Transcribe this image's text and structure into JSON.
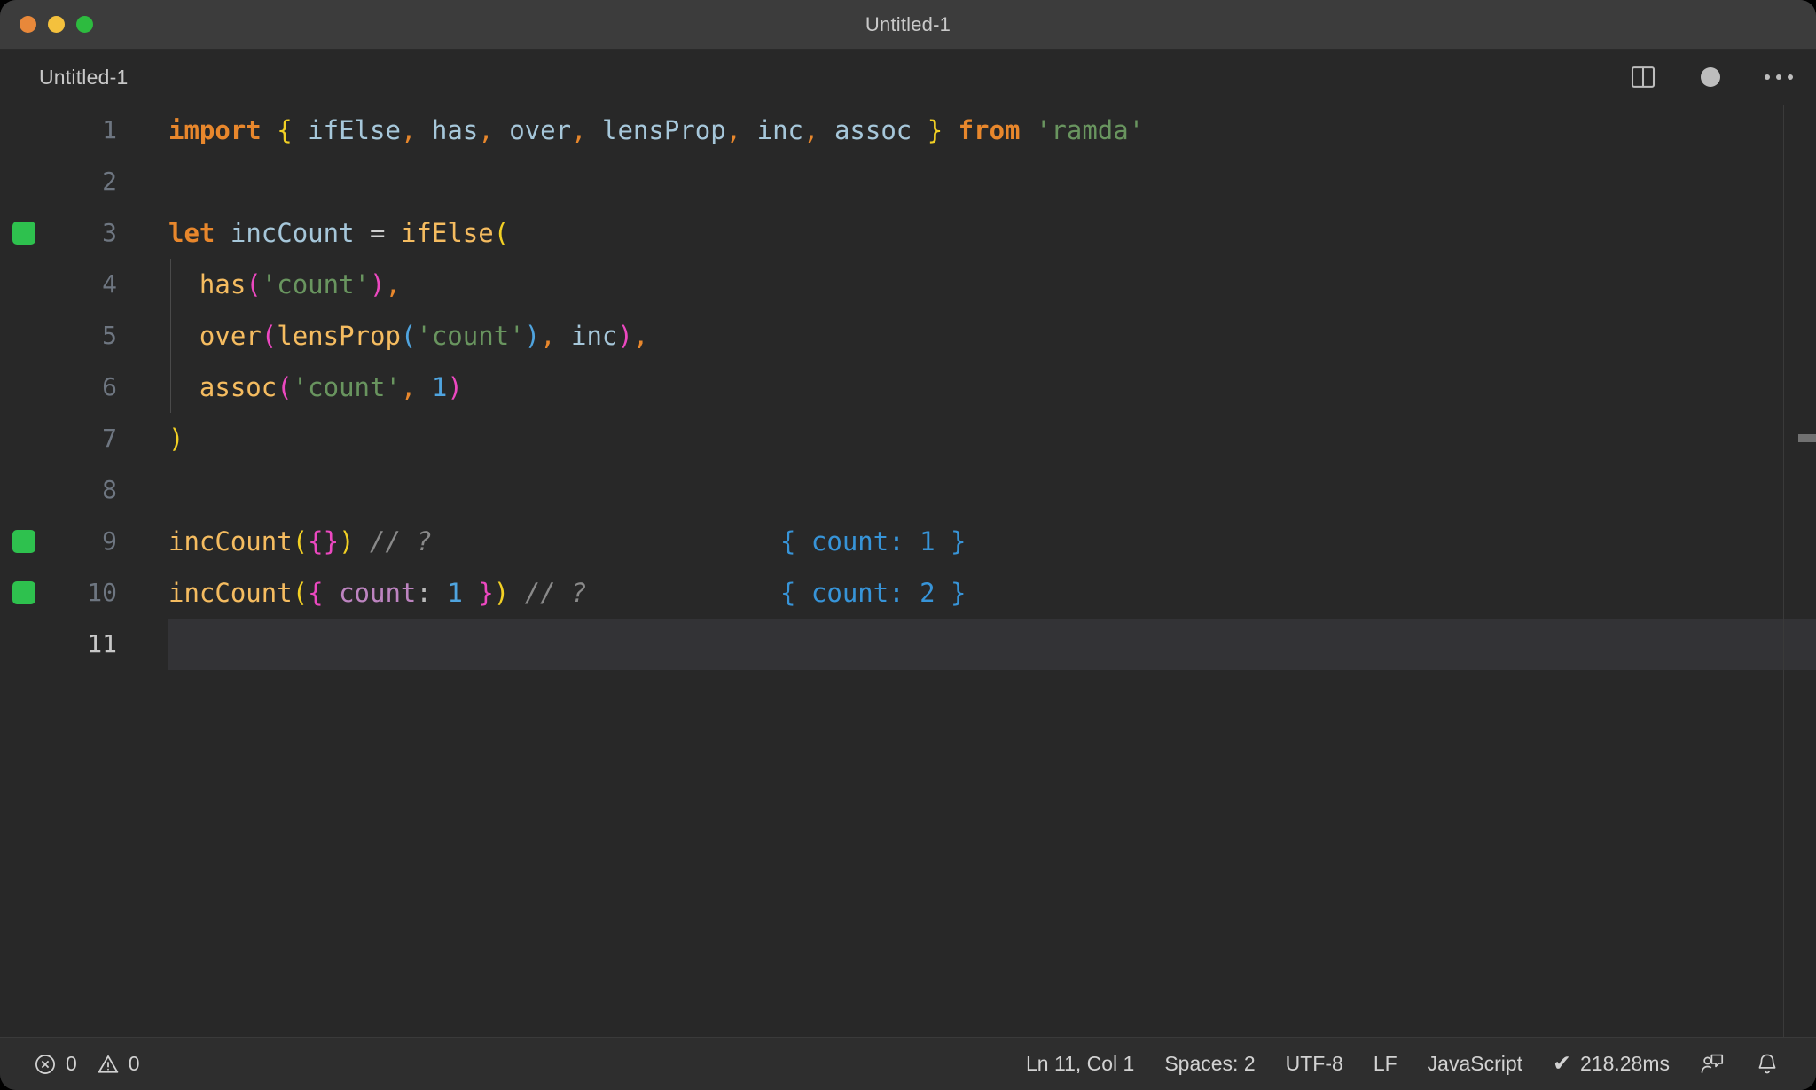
{
  "window": {
    "title": "Untitled-1",
    "traffic_lights": [
      {
        "name": "close",
        "color": "#e8883a"
      },
      {
        "name": "minimize",
        "color": "#f4c13d"
      },
      {
        "name": "maximize",
        "color": "#2dbb3f"
      }
    ]
  },
  "tabstrip": {
    "tab_label": "Untitled-1",
    "actions": [
      {
        "icon": "split-editor-icon"
      },
      {
        "icon": "unsaved-dot-icon"
      },
      {
        "icon": "more-actions-icon"
      }
    ]
  },
  "editor": {
    "language": "JavaScript",
    "current_line": 11,
    "lines": [
      {
        "n": "1",
        "marked": false,
        "indent_guide": false
      },
      {
        "n": "2",
        "marked": false,
        "indent_guide": false
      },
      {
        "n": "3",
        "marked": true,
        "indent_guide": false
      },
      {
        "n": "4",
        "marked": false,
        "indent_guide": true
      },
      {
        "n": "5",
        "marked": false,
        "indent_guide": true
      },
      {
        "n": "6",
        "marked": false,
        "indent_guide": true
      },
      {
        "n": "7",
        "marked": false,
        "indent_guide": false
      },
      {
        "n": "8",
        "marked": false,
        "indent_guide": false
      },
      {
        "n": "9",
        "marked": true,
        "indent_guide": false
      },
      {
        "n": "10",
        "marked": true,
        "indent_guide": false
      },
      {
        "n": "11",
        "marked": false,
        "indent_guide": false
      }
    ],
    "source_text": [
      "import { ifElse, has, over, lensProp, inc, assoc } from 'ramda'",
      "",
      "let incCount = ifElse(",
      "  has('count'),",
      "  over(lensProp('count'), inc),",
      "  assoc('count', 1)",
      ")",
      "",
      "incCount({}) // ?",
      "incCount({ count: 1 }) // ?",
      ""
    ],
    "inline_results": [
      {
        "line": 9,
        "value": "{ count: 1 }"
      },
      {
        "line": 10,
        "value": "{ count: 2 }"
      }
    ],
    "tokens": {
      "l1": [
        {
          "t": "import",
          "c": "kw"
        },
        {
          "t": " ",
          "c": "punc"
        },
        {
          "t": "{",
          "c": "br1"
        },
        {
          "t": " ",
          "c": "punc"
        },
        {
          "t": "ifElse",
          "c": "ident"
        },
        {
          "t": ",",
          "c": "comma"
        },
        {
          "t": " ",
          "c": "punc"
        },
        {
          "t": "has",
          "c": "ident"
        },
        {
          "t": ",",
          "c": "comma"
        },
        {
          "t": " ",
          "c": "punc"
        },
        {
          "t": "over",
          "c": "ident"
        },
        {
          "t": ",",
          "c": "comma"
        },
        {
          "t": " ",
          "c": "punc"
        },
        {
          "t": "lensProp",
          "c": "ident"
        },
        {
          "t": ",",
          "c": "comma"
        },
        {
          "t": " ",
          "c": "punc"
        },
        {
          "t": "inc",
          "c": "ident"
        },
        {
          "t": ",",
          "c": "comma"
        },
        {
          "t": " ",
          "c": "punc"
        },
        {
          "t": "assoc",
          "c": "ident"
        },
        {
          "t": " ",
          "c": "punc"
        },
        {
          "t": "}",
          "c": "br1"
        },
        {
          "t": " ",
          "c": "punc"
        },
        {
          "t": "from",
          "c": "kw"
        },
        {
          "t": " ",
          "c": "punc"
        },
        {
          "t": "'ramda'",
          "c": "str"
        }
      ],
      "l3": [
        {
          "t": "let",
          "c": "kw"
        },
        {
          "t": " ",
          "c": "punc"
        },
        {
          "t": "incCount",
          "c": "ident"
        },
        {
          "t": " ",
          "c": "punc"
        },
        {
          "t": "=",
          "c": "op"
        },
        {
          "t": " ",
          "c": "punc"
        },
        {
          "t": "ifElse",
          "c": "fn"
        },
        {
          "t": "(",
          "c": "br1"
        }
      ],
      "l4": [
        {
          "t": "  ",
          "c": "punc"
        },
        {
          "t": "has",
          "c": "fn"
        },
        {
          "t": "(",
          "c": "br2"
        },
        {
          "t": "'count'",
          "c": "str"
        },
        {
          "t": ")",
          "c": "br2"
        },
        {
          "t": ",",
          "c": "comma"
        }
      ],
      "l5": [
        {
          "t": "  ",
          "c": "punc"
        },
        {
          "t": "over",
          "c": "fn"
        },
        {
          "t": "(",
          "c": "br2"
        },
        {
          "t": "lensProp",
          "c": "fn"
        },
        {
          "t": "(",
          "c": "br3"
        },
        {
          "t": "'count'",
          "c": "str"
        },
        {
          "t": ")",
          "c": "br3"
        },
        {
          "t": ",",
          "c": "comma"
        },
        {
          "t": " ",
          "c": "punc"
        },
        {
          "t": "inc",
          "c": "ident"
        },
        {
          "t": ")",
          "c": "br2"
        },
        {
          "t": ",",
          "c": "comma"
        }
      ],
      "l6": [
        {
          "t": "  ",
          "c": "punc"
        },
        {
          "t": "assoc",
          "c": "fn"
        },
        {
          "t": "(",
          "c": "br2"
        },
        {
          "t": "'count'",
          "c": "str"
        },
        {
          "t": ",",
          "c": "comma"
        },
        {
          "t": " ",
          "c": "punc"
        },
        {
          "t": "1",
          "c": "num"
        },
        {
          "t": ")",
          "c": "br2"
        }
      ],
      "l7": [
        {
          "t": ")",
          "c": "br1"
        }
      ],
      "l9": [
        {
          "t": "incCount",
          "c": "fn"
        },
        {
          "t": "(",
          "c": "br1"
        },
        {
          "t": "{",
          "c": "br2"
        },
        {
          "t": "}",
          "c": "br2"
        },
        {
          "t": ")",
          "c": "br1"
        },
        {
          "t": " ",
          "c": "punc"
        },
        {
          "t": "// ?",
          "c": "comment"
        }
      ],
      "l10": [
        {
          "t": "incCount",
          "c": "fn"
        },
        {
          "t": "(",
          "c": "br1"
        },
        {
          "t": "{",
          "c": "br2"
        },
        {
          "t": " ",
          "c": "punc"
        },
        {
          "t": "count",
          "c": "prop"
        },
        {
          "t": ":",
          "c": "punc"
        },
        {
          "t": " ",
          "c": "punc"
        },
        {
          "t": "1",
          "c": "num"
        },
        {
          "t": " ",
          "c": "punc"
        },
        {
          "t": "}",
          "c": "br2"
        },
        {
          "t": ")",
          "c": "br1"
        },
        {
          "t": " ",
          "c": "punc"
        },
        {
          "t": "// ?",
          "c": "comment"
        }
      ]
    }
  },
  "statusbar": {
    "errors_count": "0",
    "warnings_count": "0",
    "cursor_position": "Ln 11, Col 1",
    "indentation": "Spaces: 2",
    "encoding": "UTF-8",
    "eol": "LF",
    "language_mode": "JavaScript",
    "run_time": "218.28ms",
    "icons": {
      "error": "error-circle-icon",
      "warning": "warning-triangle-icon",
      "check": "✔",
      "feedback": "feedback-icon",
      "bell": "bell-icon"
    }
  },
  "colors": {
    "window_bg": "#252526",
    "titlebar_bg": "#3c3c3c",
    "editor_bg": "#282828",
    "statusbar_bg": "#2e2e2e",
    "marker_green": "#2ec14e",
    "keyword_orange": "#e8872c",
    "function_amber": "#f5bc60",
    "string_green": "#69955f",
    "number_blue": "#4fa4df",
    "property_purple": "#bd84c0",
    "bracket_1": "#f2d024",
    "bracket_2": "#ec48c0",
    "bracket_3": "#4fa4df",
    "comment_gray": "#8a8a8a",
    "inline_result_blue": "#3794d8"
  }
}
